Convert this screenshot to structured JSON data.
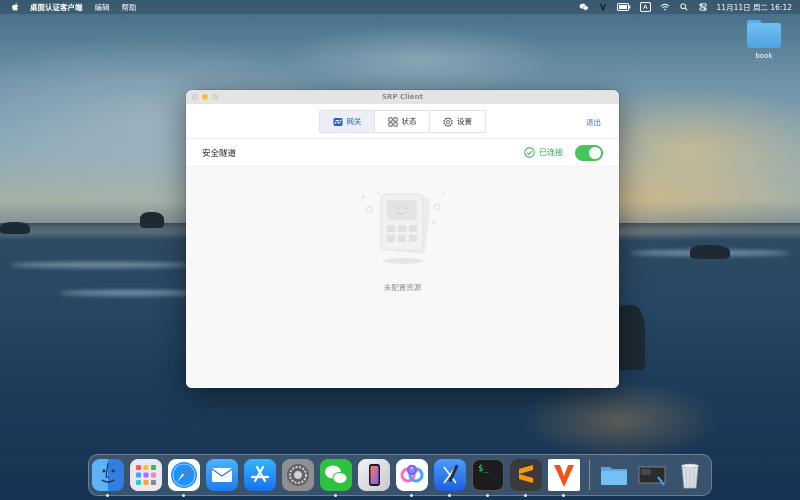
{
  "menubar": {
    "app_name": "桌面认证客户端",
    "menus": [
      "编辑",
      "帮助"
    ],
    "clock": "11月11日 周二  16:12",
    "input_method": "A"
  },
  "desktop": {
    "folder_label": "book"
  },
  "window": {
    "title": "SRP Client",
    "tabs": [
      {
        "label": "网关",
        "icon": "gateway-icon",
        "active": true
      },
      {
        "label": "状态",
        "icon": "grid-icon",
        "active": false
      },
      {
        "label": "设置",
        "icon": "gear-icon",
        "active": false
      }
    ],
    "logout_label": "退出",
    "tunnel": {
      "title": "安全隧道",
      "status": "已连接",
      "toggle_on": true
    },
    "empty_message": "未配置资源"
  },
  "colors": {
    "accent": "#2d6fe0",
    "connected": "#2fa84a",
    "toggle_on": "#45c65a"
  },
  "dock": {
    "apps": [
      {
        "name": "Finder",
        "icon": "finder-icon",
        "running": true
      },
      {
        "name": "Launchpad",
        "icon": "launchpad-icon",
        "running": false
      },
      {
        "name": "Safari",
        "icon": "safari-icon",
        "running": true
      },
      {
        "name": "Mail",
        "icon": "mail-icon",
        "running": false
      },
      {
        "name": "App Store",
        "icon": "app-store-icon",
        "running": false
      },
      {
        "name": "System Settings",
        "icon": "settings-icon",
        "running": false
      },
      {
        "name": "WeChat",
        "icon": "wechat-icon",
        "running": true
      },
      {
        "name": "iPhone Mirroring",
        "icon": "iphone-mirroring-icon",
        "running": false
      },
      {
        "name": "Feishu",
        "icon": "feishu-icon",
        "running": true
      },
      {
        "name": "Xcode",
        "icon": "xcode-icon",
        "running": true
      },
      {
        "name": "Terminal",
        "icon": "terminal-icon",
        "running": true
      },
      {
        "name": "Sublime Text",
        "icon": "sublime-icon",
        "running": true
      },
      {
        "name": "SRP Client",
        "icon": "srp-client-icon",
        "running": true
      },
      {
        "name": "Folder",
        "icon": "folder-icon",
        "running": false
      },
      {
        "name": "Screenshot",
        "icon": "screenshot-icon",
        "running": false
      },
      {
        "name": "Trash",
        "icon": "trash-icon",
        "running": false
      }
    ],
    "terminal_prompt": "$_"
  }
}
